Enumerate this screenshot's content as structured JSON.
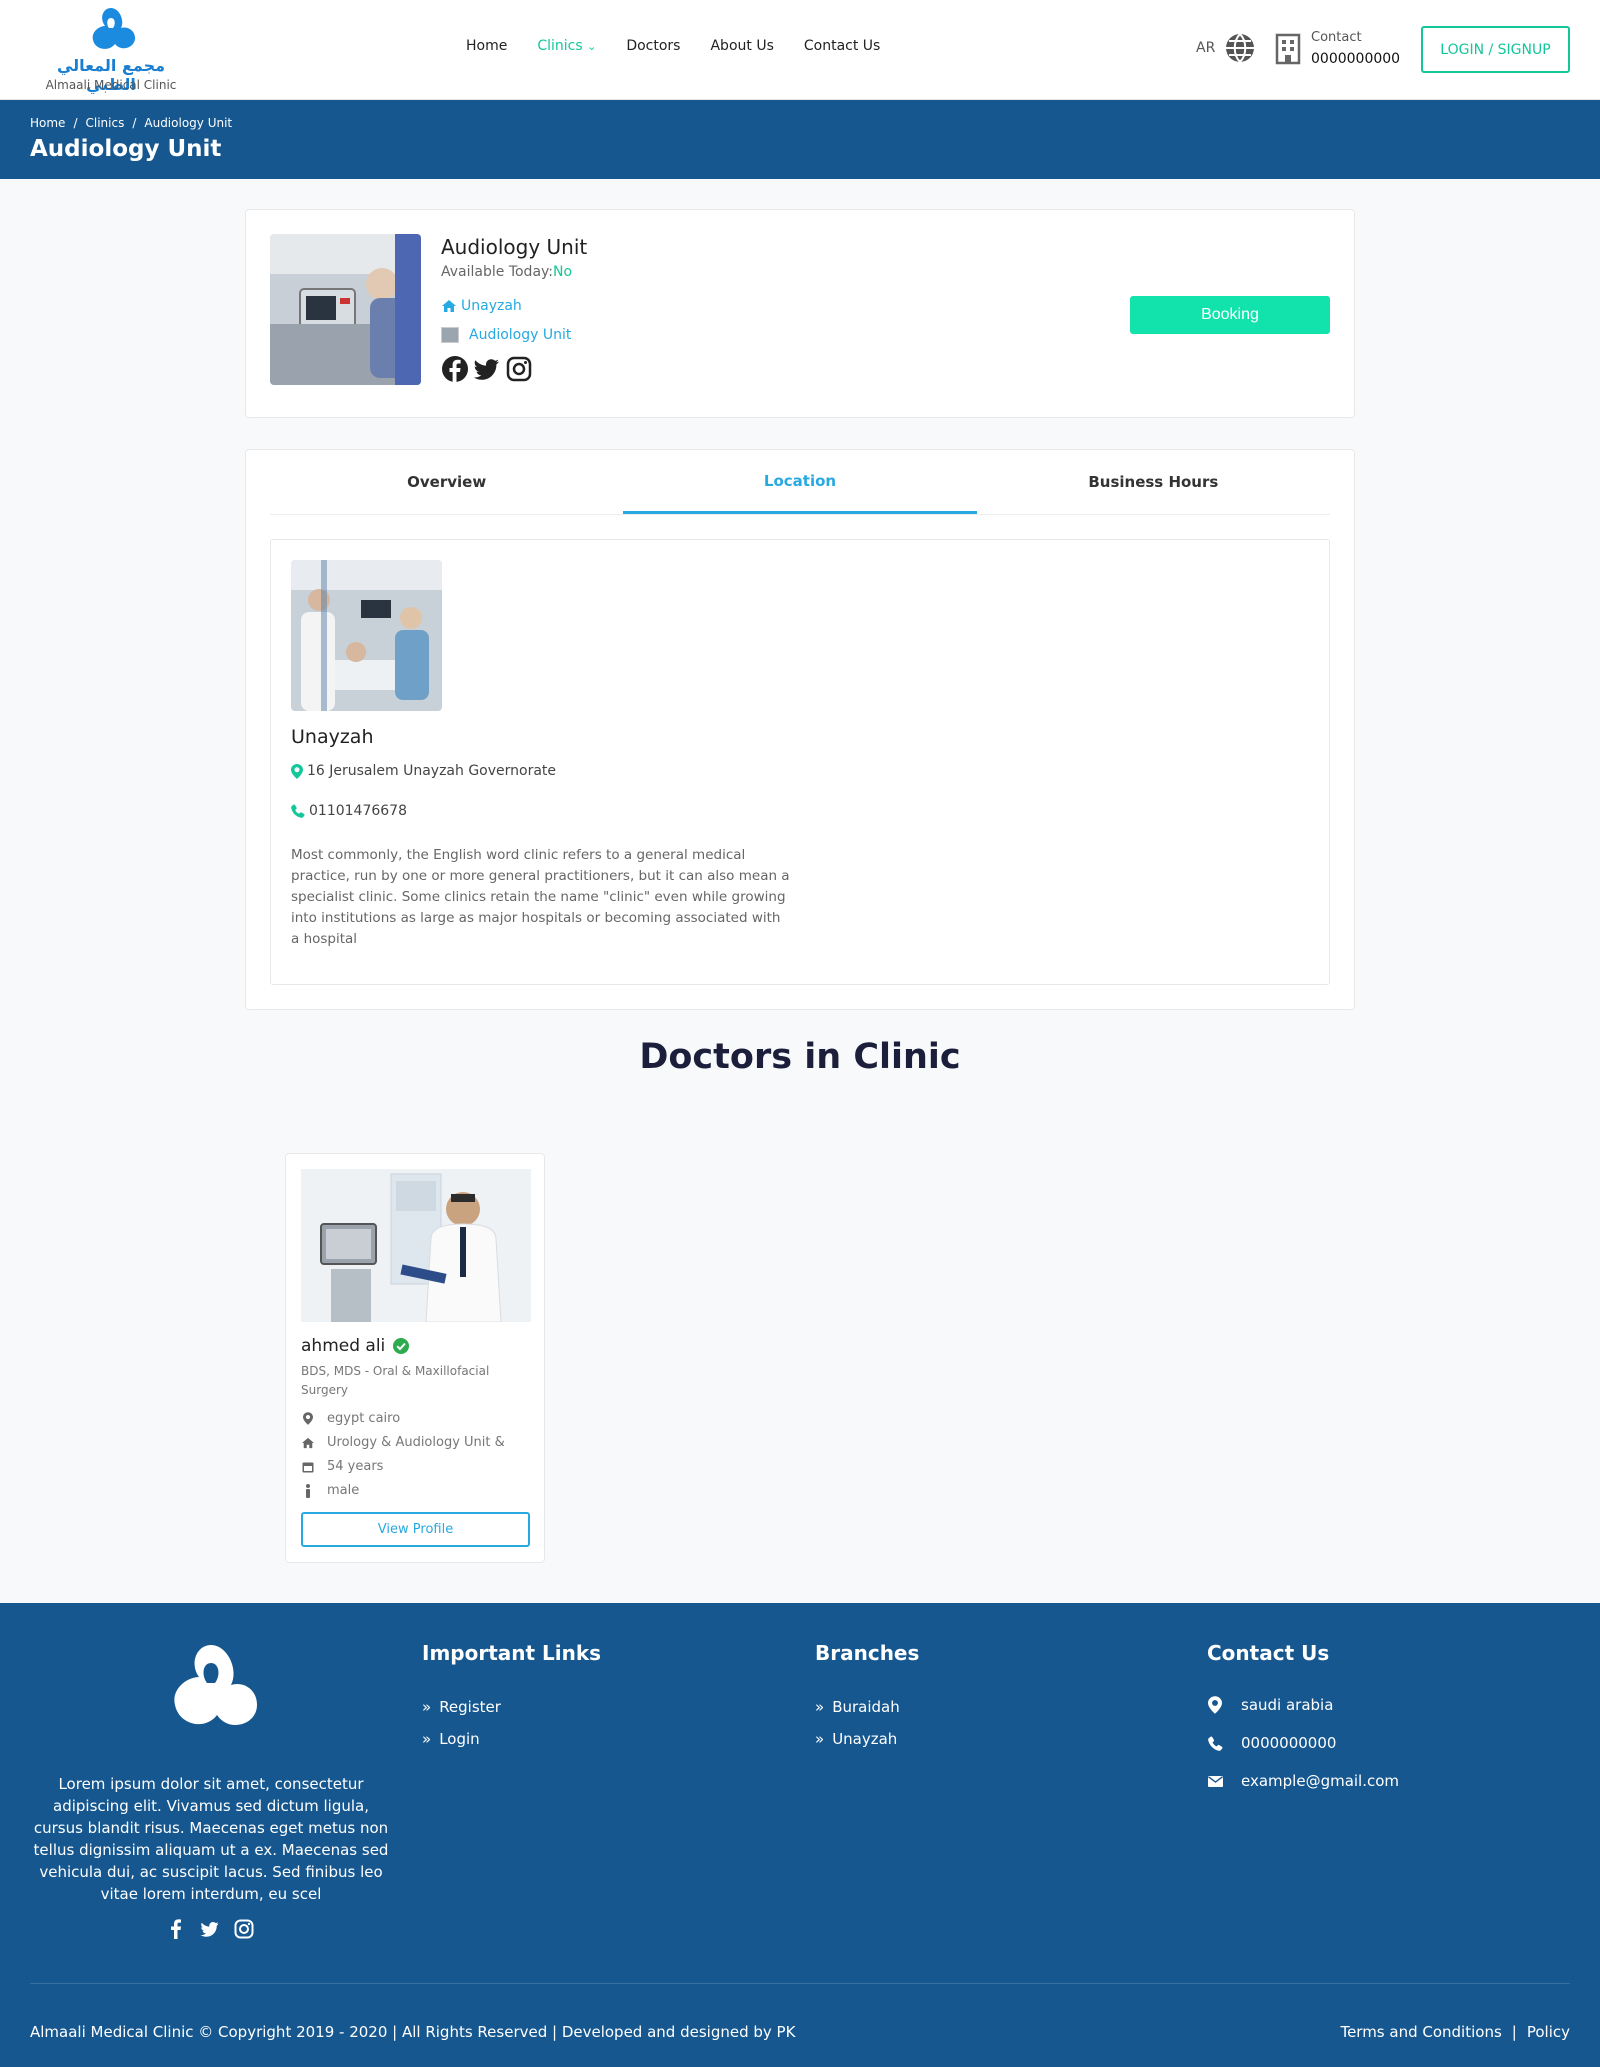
{
  "brand": {
    "arabic_name": "مجمع المعالي الطبي",
    "english_name": "Almaali Medical Clinic"
  },
  "nav": {
    "items": [
      "Home",
      "Clinics",
      "Doctors",
      "About Us",
      "Contact Us"
    ]
  },
  "header": {
    "lang": "AR",
    "contact_label": "Contact",
    "contact_number": "0000000000",
    "login_label": "LOGIN / SIGNUP"
  },
  "breadcrumb": {
    "items": [
      "Home",
      "Clinics",
      "Audiology Unit"
    ],
    "sep": "/"
  },
  "page_title": "Audiology Unit",
  "clinic": {
    "name": "Audiology Unit",
    "available_label": "Available Today:",
    "available_value": "No",
    "branch": "Unayzah",
    "unit": "Audiology Unit",
    "booking_label": "Booking"
  },
  "tabs": [
    "Overview",
    "Location",
    "Business Hours"
  ],
  "location": {
    "name": "Unayzah",
    "address": "16 Jerusalem Unayzah Governorate",
    "phone": "01101476678",
    "description": "Most commonly, the English word clinic refers to a general medical practice, run by one or more general practitioners, but it can also mean a specialist clinic. Some clinics retain the name \"clinic\" even while growing into institutions as large as major hospitals or becoming associated with a hospital"
  },
  "doctors_heading": "Doctors in Clinic",
  "doctor": {
    "name": "ahmed ali",
    "specialty": "BDS, MDS - Oral & Maxillofacial Surgery",
    "location": "egypt cairo",
    "department": "Urology & Audiology Unit &",
    "age": "54 years",
    "gender": "male",
    "view_label": "View Profile"
  },
  "footer": {
    "about": "Lorem ipsum dolor sit amet, consectetur adipiscing elit. Vivamus sed dictum ligula, cursus blandit risus. Maecenas eget metus non tellus dignissim aliquam ut a ex. Maecenas sed vehicula dui, ac suscipit lacus. Sed finibus leo vitae lorem interdum, eu scel",
    "links_title": "Important Links",
    "links": [
      "Register",
      "Login"
    ],
    "branches_title": "Branches",
    "branches": [
      "Buraidah",
      "Unayzah"
    ],
    "contact_title": "Contact Us",
    "contact": {
      "country": "saudi arabia",
      "phone": "0000000000",
      "email": "example@gmail.com"
    },
    "copyright": "Almaali Medical Clinic © Copyright 2019 - 2020 | All Rights Reserved | Developed and designed by PK",
    "terms": "Terms and Conditions",
    "legal_sep": "|",
    "policy": "Policy"
  },
  "colors": {
    "primary": "#16578f",
    "accent": "#14c79b",
    "link": "#27a9e1",
    "booking": "#12e2ac"
  }
}
